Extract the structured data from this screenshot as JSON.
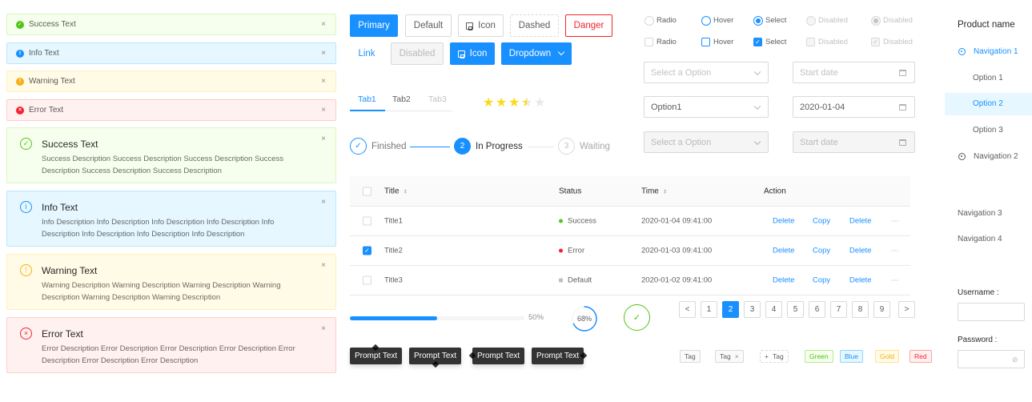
{
  "alerts_small": [
    {
      "type": "success",
      "text": "Success Text",
      "icon": "check-circle-filled-icon",
      "color": "#52c41a",
      "close": "×"
    },
    {
      "type": "info",
      "text": "Info Text",
      "icon": "info-circle-filled-icon",
      "color": "#1890ff",
      "close": "×"
    },
    {
      "type": "warning",
      "text": "Warning Text",
      "icon": "exclamation-circle-filled-icon",
      "color": "#faad14",
      "close": "×"
    },
    {
      "type": "error",
      "text": "Error Text",
      "icon": "close-circle-filled-icon",
      "color": "#f5222d",
      "close": "×"
    }
  ],
  "alerts_big": [
    {
      "type": "success",
      "title": "Success Text",
      "description": "Success Description Success Description Success Description Success Description Success Description Success Description",
      "icon_glyph": "✓",
      "color": "#52c41a",
      "close": "×"
    },
    {
      "type": "info",
      "title": "Info Text",
      "description": "Info Description Info Description Info Description Info Description Info Description Info Description Info Description Info Description",
      "icon_glyph": "i",
      "color": "#1890ff",
      "close": "×"
    },
    {
      "type": "warning",
      "title": "Warning Text",
      "description": "Warning Description Warning Description Warning Description Warning Description Warning Description Warning Description",
      "icon_glyph": "!",
      "color": "#faad14",
      "close": "×"
    },
    {
      "type": "error",
      "title": "Error Text",
      "description": "Error Description Error Description Error Description Error Description Error Description Error Description Error Description",
      "icon_glyph": "×",
      "color": "#f5222d",
      "close": "×"
    }
  ],
  "buttons": {
    "primary": "Primary",
    "default": "Default",
    "icon": "Icon",
    "dashed": "Dashed",
    "danger": "Danger",
    "link": "Link",
    "disabled": "Disabled",
    "icon_primary": "Icon",
    "dropdown": "Dropdown"
  },
  "tabs": [
    {
      "label": "Tab1",
      "state": "active"
    },
    {
      "label": "Tab2",
      "state": "normal"
    },
    {
      "label": "Tab3",
      "state": "disabled"
    }
  ],
  "rating": {
    "value": 3.5,
    "max": 5,
    "glyph": "★"
  },
  "steps": [
    {
      "label": "Finished",
      "status": "finish",
      "glyph": "✓"
    },
    {
      "label": "In Progress",
      "status": "process",
      "glyph": "2"
    },
    {
      "label": "Waiting",
      "status": "wait",
      "glyph": "3"
    }
  ],
  "table": {
    "columns": {
      "title": "Title",
      "status": "Status",
      "time": "Time",
      "action": "Action",
      "sort_glyph": "⬍"
    },
    "rows": [
      {
        "title": "Title1",
        "status": "Success",
        "status_color": "#52c41a",
        "time": "2020-01-04  09:41:00",
        "checked": false
      },
      {
        "title": "Title2",
        "status": "Error",
        "status_color": "#f5222d",
        "time": "2020-01-03  09:41:00",
        "checked": true
      },
      {
        "title": "Title3",
        "status": "Default",
        "status_color": "#bfbfbf",
        "time": "2020-01-02  09:41:00",
        "checked": false
      }
    ],
    "actions": {
      "delete": "Delete",
      "copy": "Copy",
      "more": "···"
    }
  },
  "progress": {
    "line_percent": 50,
    "line_label": "50%",
    "circle_percent": 68,
    "circle_label": "68%",
    "done_glyph": "✓"
  },
  "tooltips": [
    "Prompt Text",
    "Prompt Text",
    "Prompt Text",
    "Prompt Text"
  ],
  "radios": [
    {
      "label": "Radio",
      "state": "normal"
    },
    {
      "label": "Hover",
      "state": "hover"
    },
    {
      "label": "Select",
      "state": "sel"
    },
    {
      "label": "Disabled",
      "state": "dis"
    },
    {
      "label": "Disabled",
      "state": "dis sel"
    }
  ],
  "checkboxes": [
    {
      "label": "Radio",
      "state": "normal",
      "glyph": ""
    },
    {
      "label": "Hover",
      "state": "hover",
      "glyph": ""
    },
    {
      "label": "Select",
      "state": "sel",
      "glyph": "✓"
    },
    {
      "label": "Disabled",
      "state": "dis",
      "glyph": ""
    },
    {
      "label": "Disabled",
      "state": "dis",
      "glyph": "✓"
    }
  ],
  "selects": [
    {
      "value": "",
      "placeholder": "Select a Option",
      "state": "placeholder"
    },
    {
      "value": "Option1",
      "placeholder": "",
      "state": "filled"
    },
    {
      "value": "",
      "placeholder": "Select a Option",
      "state": "disabled"
    }
  ],
  "datepickers": [
    {
      "value": "",
      "placeholder": "Start date",
      "state": "placeholder"
    },
    {
      "value": "2020-01-04",
      "placeholder": "",
      "state": "filled"
    },
    {
      "value": "",
      "placeholder": "Start date",
      "state": "disabled"
    }
  ],
  "pagination": {
    "prev": "<",
    "next": ">",
    "pages": [
      "1",
      "2",
      "3",
      "4",
      "5",
      "6",
      "7",
      "8",
      "9"
    ],
    "current": "2"
  },
  "tags": [
    {
      "label": "Tag",
      "kind": "default"
    },
    {
      "label": "Tag",
      "kind": "closable",
      "close": "×"
    },
    {
      "label": "Tag",
      "kind": "add",
      "prefix": "+"
    },
    {
      "label": "Green",
      "kind": "color",
      "color": "#52c41a",
      "bg": "#f6ffed",
      "border": "#b7eb8f"
    },
    {
      "label": "Blue",
      "kind": "color",
      "color": "#1890ff",
      "bg": "#e6f7ff",
      "border": "#91d5ff"
    },
    {
      "label": "Gold",
      "kind": "color",
      "color": "#faad14",
      "bg": "#fffbe6",
      "border": "#ffe58f"
    },
    {
      "label": "Red",
      "kind": "color",
      "color": "#f5222d",
      "bg": "#fff1f0",
      "border": "#ffa39e"
    }
  ],
  "menu": {
    "title": "Product name",
    "nav1": "Navigation 1",
    "options": [
      "Option 1",
      "Option 2",
      "Option 3"
    ],
    "selected_option": "Option 2",
    "nav2": "Navigation 2",
    "nav3": "Navigation 3",
    "nav4": "Navigation 4"
  },
  "form": {
    "username_label": "Username :",
    "username_value": "",
    "password_label": "Password :",
    "password_value": ""
  },
  "colors": {
    "primary": "#1890ff",
    "success": "#52c41a",
    "warning": "#faad14",
    "error": "#f5222d"
  }
}
